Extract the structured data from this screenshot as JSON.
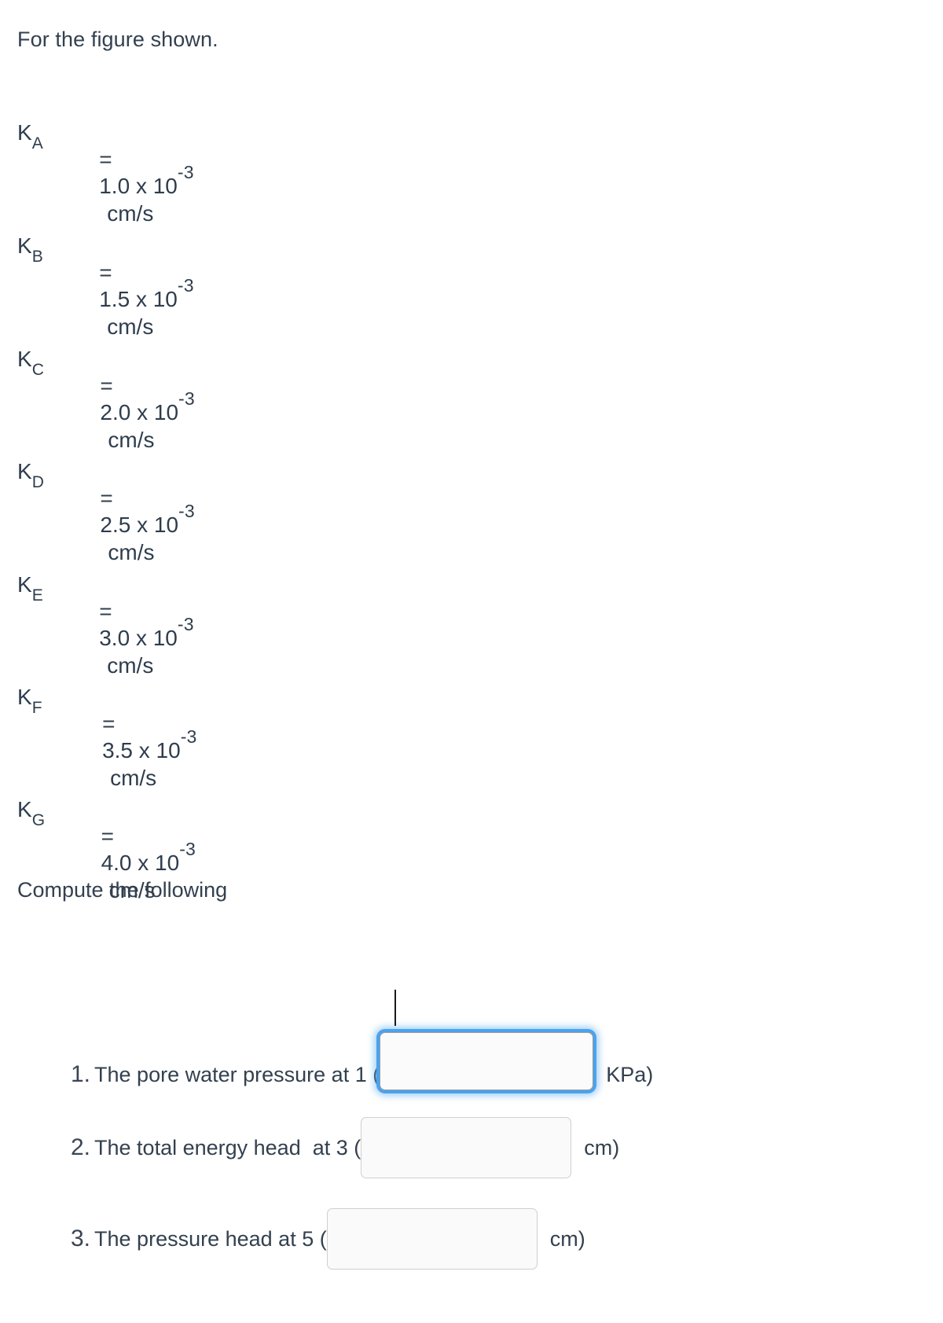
{
  "intro": "For the figure shown.",
  "equations": [
    {
      "symbol": "K",
      "subscript": "A",
      "equals": "=",
      "mantissa": "1.0 x 10",
      "exponent": "-3",
      "unit": "cm/s"
    },
    {
      "symbol": "K",
      "subscript": "B",
      "equals": "=",
      "mantissa": "1.5 x 10",
      "exponent": "-3",
      "unit": "cm/s"
    },
    {
      "symbol": "K",
      "subscript": "C",
      "equals": "=",
      "mantissa": "2.0 x 10",
      "exponent": "-3",
      "unit": "cm/s"
    },
    {
      "symbol": "K",
      "subscript": "D",
      "equals": "=",
      "mantissa": "2.5 x 10",
      "exponent": "-3",
      "unit": "cm/s"
    },
    {
      "symbol": "K",
      "subscript": "E",
      "equals": "=",
      "mantissa": "3.0 x 10",
      "exponent": "-3",
      "unit": "cm/s"
    },
    {
      "symbol": "K",
      "subscript": "F",
      "equals": "=",
      "mantissa": "3.5 x 10",
      "exponent": "-3",
      "unit": "cm/s"
    },
    {
      "symbol": "K",
      "subscript": "G",
      "equals": "=",
      "mantissa": "4.0 x 10",
      "exponent": "-3",
      "unit": "cm/s"
    }
  ],
  "compute_heading": "Compute the following",
  "questions": [
    {
      "number": "1.",
      "text": "The pore water pressure at 1 (",
      "value": "",
      "placeholder": "",
      "unit": "KPa)",
      "focused": true
    },
    {
      "number": "2.",
      "text": "The total energy head  at 3 (",
      "value": "",
      "placeholder": "",
      "unit": "cm)",
      "focused": false
    },
    {
      "number": "3.",
      "text": "The pressure head at 5 (",
      "value": "",
      "placeholder": "",
      "unit": "cm)",
      "focused": false
    }
  ],
  "colors": {
    "text": "#33404f",
    "focus_ring": "#49a3ef",
    "box_border": "#cfcfcf",
    "box_fill": "#fafafa",
    "background": "#ffffff"
  }
}
